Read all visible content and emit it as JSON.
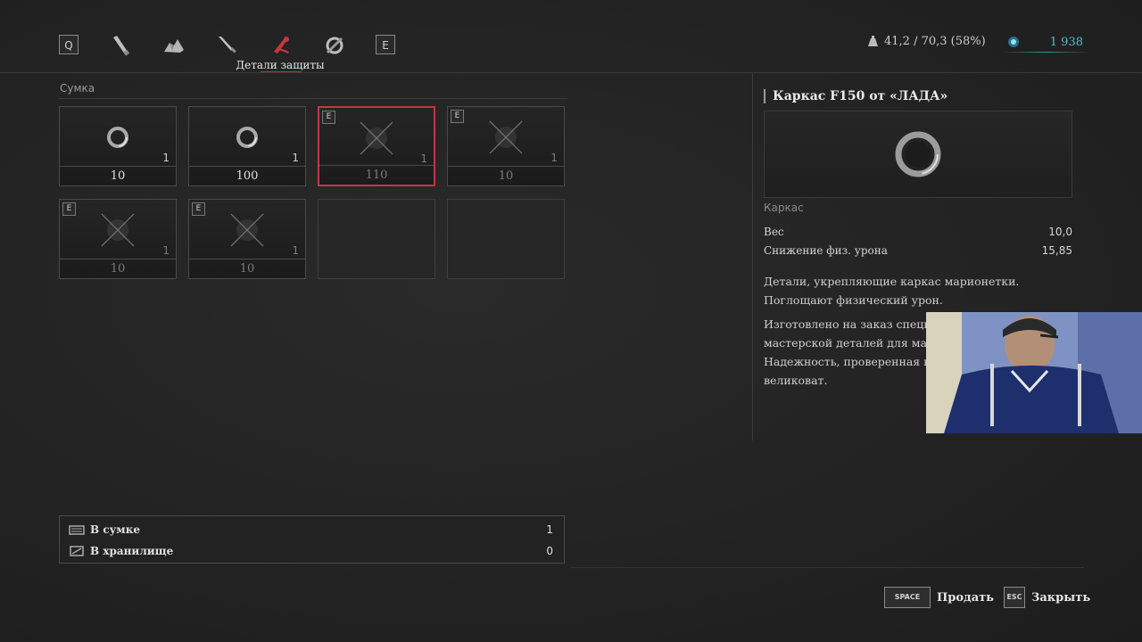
{
  "header": {
    "key_left": "Q",
    "key_right": "E",
    "tabs": [
      {
        "icon": "pipette-icon",
        "active": false
      },
      {
        "icon": "rubble-icon",
        "active": false
      },
      {
        "icon": "dagger-icon",
        "active": false
      },
      {
        "icon": "defense-parts-icon",
        "active": true
      },
      {
        "icon": "gear-tools-icon",
        "active": false
      }
    ],
    "active_tab_label": "Детали защиты",
    "weight": "41,2 / 70,3 (58%)",
    "currency": "1 938",
    "colors": {
      "accent": "#c8353f",
      "currency": "#4fc0c8"
    }
  },
  "bag": {
    "label": "Сумка",
    "slots": [
      {
        "qty": "1",
        "value": "10",
        "equipped": false,
        "selected": false,
        "dim": false,
        "icon": "ring-icon"
      },
      {
        "qty": "1",
        "value": "100",
        "equipped": false,
        "selected": false,
        "dim": false,
        "icon": "ring-icon"
      },
      {
        "qty": "1",
        "value": "110",
        "equipped": true,
        "equip_tag": "E",
        "selected": true,
        "dim": true,
        "icon": "crossed-part-icon"
      },
      {
        "qty": "1",
        "value": "10",
        "equipped": true,
        "equip_tag": "E",
        "selected": false,
        "dim": true,
        "icon": "crossed-part-icon"
      },
      {
        "qty": "1",
        "value": "10",
        "equipped": true,
        "equip_tag": "E",
        "selected": false,
        "dim": true,
        "icon": "crossed-part-icon"
      },
      {
        "qty": "1",
        "value": "10",
        "equipped": true,
        "equip_tag": "E",
        "selected": false,
        "dim": true,
        "icon": "crossed-part-icon"
      },
      {
        "empty": true
      },
      {
        "empty": true
      }
    ]
  },
  "storage": {
    "in_bag_label": "В сумке",
    "in_bag_value": "1",
    "in_storage_label": "В хранилище",
    "in_storage_value": "0"
  },
  "detail": {
    "title": "Каркас F150 от «ЛАДА»",
    "category": "Каркас",
    "stats": [
      {
        "label": "Вес",
        "value": "10,0"
      },
      {
        "label": "Снижение физ. урона",
        "value": "15,85"
      }
    ],
    "desc1_line1": "Детали, укрепляющие каркас марионетки.",
    "desc1_line2": "Поглощают физический урон.",
    "desc2_line1": "Изготовлено на заказ специ",
    "desc2_line2": "мастерской деталей для мар",
    "desc2_line3": "Надежность, проверенная вр",
    "desc2_line4": "великоват."
  },
  "actions": {
    "sell_key": "SPACE",
    "sell_label": "Продать",
    "close_key": "ESC",
    "close_label": "Закрыть"
  }
}
